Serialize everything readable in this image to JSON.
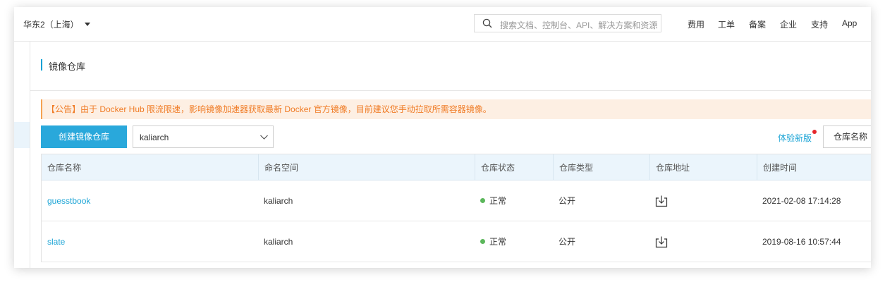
{
  "topbar": {
    "region": "华东2（上海）",
    "search_placeholder": "搜索文档、控制台、API、解决方案和资源",
    "nav": [
      "费用",
      "工单",
      "备案",
      "企业",
      "支持",
      "App"
    ]
  },
  "page": {
    "title": "镜像仓库",
    "notice": "【公告】由于 Docker Hub 限流限速，影响镜像加速器获取最新 Docker 官方镜像，目前建议您手动拉取所需容器镜像。"
  },
  "toolbar": {
    "create_label": "创建镜像仓库",
    "namespace_value": "kaliarch",
    "new_version_label": "体验新版",
    "sort_label": "仓库名称"
  },
  "table": {
    "columns": [
      "仓库名称",
      "命名空间",
      "仓库状态",
      "仓库类型",
      "仓库地址",
      "创建时间"
    ],
    "rows": [
      {
        "name": "guesstbook",
        "namespace": "kaliarch",
        "status": "正常",
        "type": "公开",
        "created": "2021-02-08 17:14:28"
      },
      {
        "name": "slate",
        "namespace": "kaliarch",
        "status": "正常",
        "type": "公开",
        "created": "2019-08-16 10:57:44"
      }
    ]
  },
  "colors": {
    "accent": "#29a8db",
    "link": "#1ea5d6",
    "notice_text": "#f07c26",
    "notice_bg": "#fdefe3",
    "status_ok": "#5bb75b",
    "badge_red": "#e5262b"
  },
  "icons": {
    "search": "search-icon",
    "dropdown": "chevron-down-icon",
    "address": "download-icon"
  }
}
